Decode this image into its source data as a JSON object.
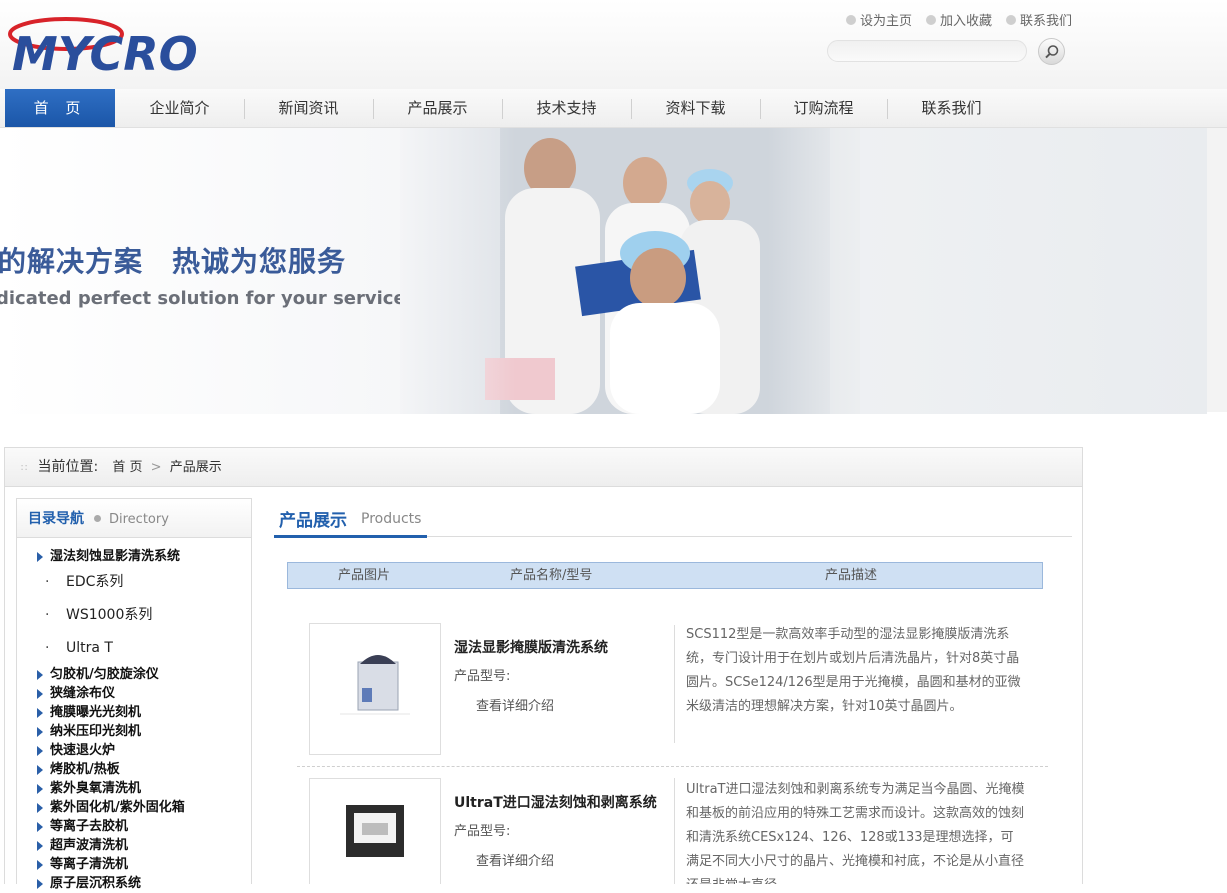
{
  "header": {
    "top_links": [
      "设为主页",
      "加入收藏",
      "联系我们"
    ],
    "search_placeholder": ""
  },
  "nav": {
    "items": [
      "首 页",
      "企业简介",
      "新闻资讯",
      "产品展示",
      "技术支持",
      "资料下载",
      "订购流程",
      "联系我们"
    ],
    "active_index": 0
  },
  "banner": {
    "slogan_cn": "的解决方案　热诚为您服务",
    "slogan_en": "dicated perfect solution for your service"
  },
  "breadcrumb": {
    "label": "当前位置:",
    "items": [
      "首 页",
      "产品展示"
    ],
    "separator": ">"
  },
  "sidebar": {
    "title": "目录导航",
    "title_en": "Directory",
    "menu": [
      {
        "type": "cat",
        "label": "湿法刻蚀显影清洗系统"
      },
      {
        "type": "sub",
        "label": "EDC系列"
      },
      {
        "type": "sub",
        "label": "WS1000系列"
      },
      {
        "type": "sub",
        "label": "Ultra T"
      },
      {
        "type": "cat",
        "label": "匀胶机/匀胶旋涂仪"
      },
      {
        "type": "cat",
        "label": "狭缝涂布仪"
      },
      {
        "type": "cat",
        "label": "掩膜曝光光刻机"
      },
      {
        "type": "cat",
        "label": "纳米压印光刻机"
      },
      {
        "type": "cat",
        "label": "快速退火炉"
      },
      {
        "type": "cat",
        "label": "烤胶机/热板"
      },
      {
        "type": "cat",
        "label": "紫外臭氧清洗机"
      },
      {
        "type": "cat",
        "label": "紫外固化机/紫外固化箱"
      },
      {
        "type": "cat",
        "label": "等离子去胶机"
      },
      {
        "type": "cat",
        "label": "超声波清洗机"
      },
      {
        "type": "cat",
        "label": "等离子清洗机"
      },
      {
        "type": "cat",
        "label": "原子层沉积系统"
      }
    ]
  },
  "main": {
    "title": "产品展示",
    "title_en": "Products",
    "table_headers": [
      "产品图片",
      "产品名称/型号",
      "产品描述"
    ],
    "products": [
      {
        "name": "湿法显影掩膜版清洗系统",
        "model_label": "产品型号:",
        "more": "查看详细介绍",
        "desc": "SCS112型是一款高效率手动型的湿法显影掩膜版清洗系统，专门设计用于在划片或划片后清洗晶片，针对8英寸晶圆片。SCSe124/126型是用于光掩模，晶圆和基材的亚微米级清洁的理想解决方案，针对10英寸晶圆片。"
      },
      {
        "name": "UltraT进口湿法刻蚀和剥离系统",
        "model_label": "产品型号:",
        "more": "查看详细介绍",
        "desc": "UltraT进口湿法刻蚀和剥离系统专为满足当今晶圆、光掩模和基板的前沿应用的特殊工艺需求而设计。这款高效的蚀刻和清洗系统CESx124、126、128或133是理想选择，可满足不同大小尺寸的晶片、光掩模和衬底，不论是从小直径还是非常大直径"
      }
    ]
  },
  "colors": {
    "brand_blue": "#2260ad",
    "nav_active": "#2f6fc4",
    "table_header_bg": "#cfe0f3"
  }
}
